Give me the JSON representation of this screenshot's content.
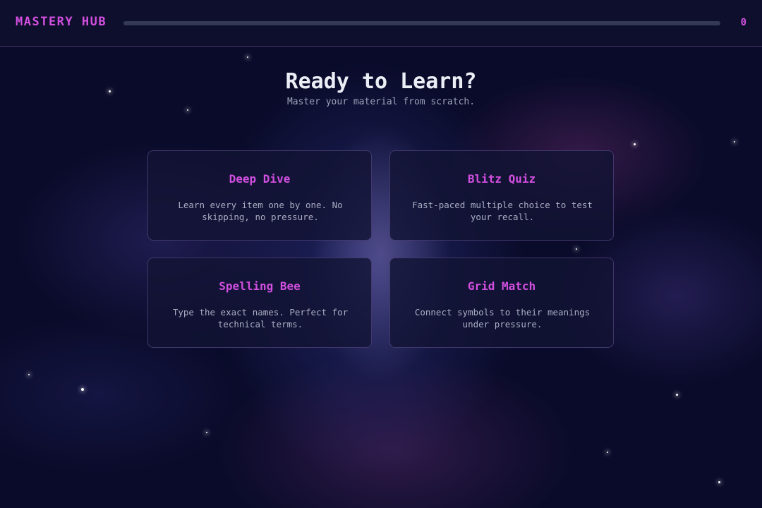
{
  "header": {
    "brand": "MASTERY HUB",
    "progress": 0,
    "score": "0"
  },
  "hero": {
    "title": "Ready to Learn?",
    "subtitle": "Master your material from scratch."
  },
  "modes": [
    {
      "title": "Deep Dive",
      "description": "Learn every item one by one. No skipping, no pressure."
    },
    {
      "title": "Blitz Quiz",
      "description": "Fast-paced multiple choice to test your recall."
    },
    {
      "title": "Spelling Bee",
      "description": "Type the exact names. Perfect for technical terms."
    },
    {
      "title": "Grid Match",
      "description": "Connect symbols to their meanings under pressure."
    }
  ],
  "colors": {
    "accent": "#d34fe0",
    "background": "#0a0b2a",
    "card_border": "#5a4a80"
  }
}
